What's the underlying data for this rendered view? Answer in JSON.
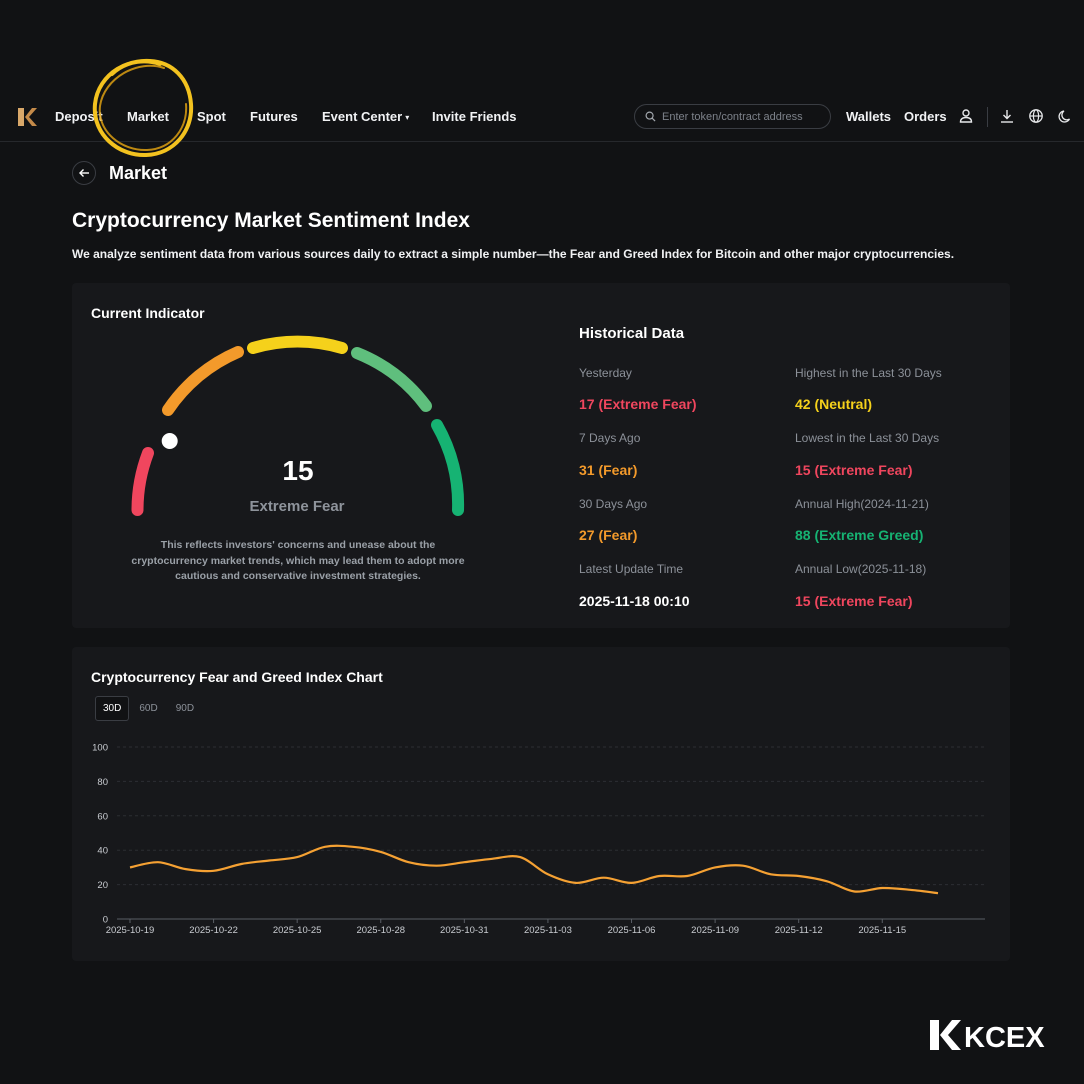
{
  "nav": {
    "items": [
      "Deposit",
      "Market",
      "Spot",
      "Futures",
      "Event Center",
      "Invite Friends"
    ],
    "search_placeholder": "Enter token/contract address",
    "wallets": "Wallets",
    "orders": "Orders"
  },
  "header": {
    "back_title": "Market",
    "title": "Cryptocurrency Market Sentiment Index",
    "lead": "We analyze sentiment data from various sources daily to extract a simple number—the Fear and Greed Index for Bitcoin and other major cryptocurrencies."
  },
  "indicator": {
    "title": "Current Indicator",
    "value": "15",
    "label": "Extreme Fear",
    "description": "This reflects investors' concerns and unease about the cryptocurrency market trends, which may lead them to adopt more cautious and conservative investment strategies.",
    "gauge_fraction": 0.15
  },
  "historical": {
    "title": "Historical Data",
    "rows": [
      {
        "label": "Yesterday",
        "value": "17 (Extreme Fear)",
        "tone": "red"
      },
      {
        "label": "Highest in the Last 30 Days",
        "value": "42 (Neutral)",
        "tone": "yellow"
      },
      {
        "label": "7 Days Ago",
        "value": "31 (Fear)",
        "tone": "orange"
      },
      {
        "label": "Lowest in the Last 30 Days",
        "value": "15 (Extreme Fear)",
        "tone": "red"
      },
      {
        "label": "30 Days Ago",
        "value": "27 (Fear)",
        "tone": "orange"
      },
      {
        "label": "Annual High(2024-11-21)",
        "value": "88 (Extreme Greed)",
        "tone": "green"
      },
      {
        "label": "Latest Update Time",
        "value": "2025-11-18 00:10",
        "tone": "white"
      },
      {
        "label": "Annual Low(2025-11-18)",
        "value": "15 (Extreme Fear)",
        "tone": "red"
      }
    ]
  },
  "chart_section": {
    "title": "Cryptocurrency Fear and Greed Index Chart",
    "tabs": [
      "30D",
      "60D",
      "90D"
    ],
    "active_tab": "30D"
  },
  "colors": {
    "line": "#f5a133",
    "red": "#f0465e",
    "orange": "#f39a2b",
    "yellow": "#f5d11b",
    "green": "#16b373",
    "light_green": "#5fbf7d"
  },
  "brand": "KCEX",
  "chart_data": {
    "type": "line",
    "title": "Cryptocurrency Fear and Greed Index Chart",
    "xlabel": "",
    "ylabel": "",
    "ylim": [
      0,
      100
    ],
    "yticks": [
      0,
      20,
      40,
      60,
      80,
      100
    ],
    "grid": true,
    "x_tick_labels": [
      "2025-10-19",
      "2025-10-22",
      "2025-10-25",
      "2025-10-28",
      "2025-10-31",
      "2025-11-03",
      "2025-11-06",
      "2025-11-09",
      "2025-11-12",
      "2025-11-15"
    ],
    "x": [
      "2025-10-19",
      "2025-10-20",
      "2025-10-21",
      "2025-10-22",
      "2025-10-23",
      "2025-10-24",
      "2025-10-25",
      "2025-10-26",
      "2025-10-27",
      "2025-10-28",
      "2025-10-29",
      "2025-10-30",
      "2025-10-31",
      "2025-11-01",
      "2025-11-02",
      "2025-11-03",
      "2025-11-04",
      "2025-11-05",
      "2025-11-06",
      "2025-11-07",
      "2025-11-08",
      "2025-11-09",
      "2025-11-10",
      "2025-11-11",
      "2025-11-12",
      "2025-11-13",
      "2025-11-14",
      "2025-11-15",
      "2025-11-16",
      "2025-11-17"
    ],
    "series": [
      {
        "values": [
          30,
          33,
          29,
          28,
          32,
          34,
          36,
          42,
          42,
          39,
          33,
          31,
          33,
          35,
          36,
          26,
          21,
          24,
          21,
          25,
          25,
          30,
          31,
          26,
          25,
          22,
          16,
          18,
          17,
          15
        ]
      }
    ]
  }
}
